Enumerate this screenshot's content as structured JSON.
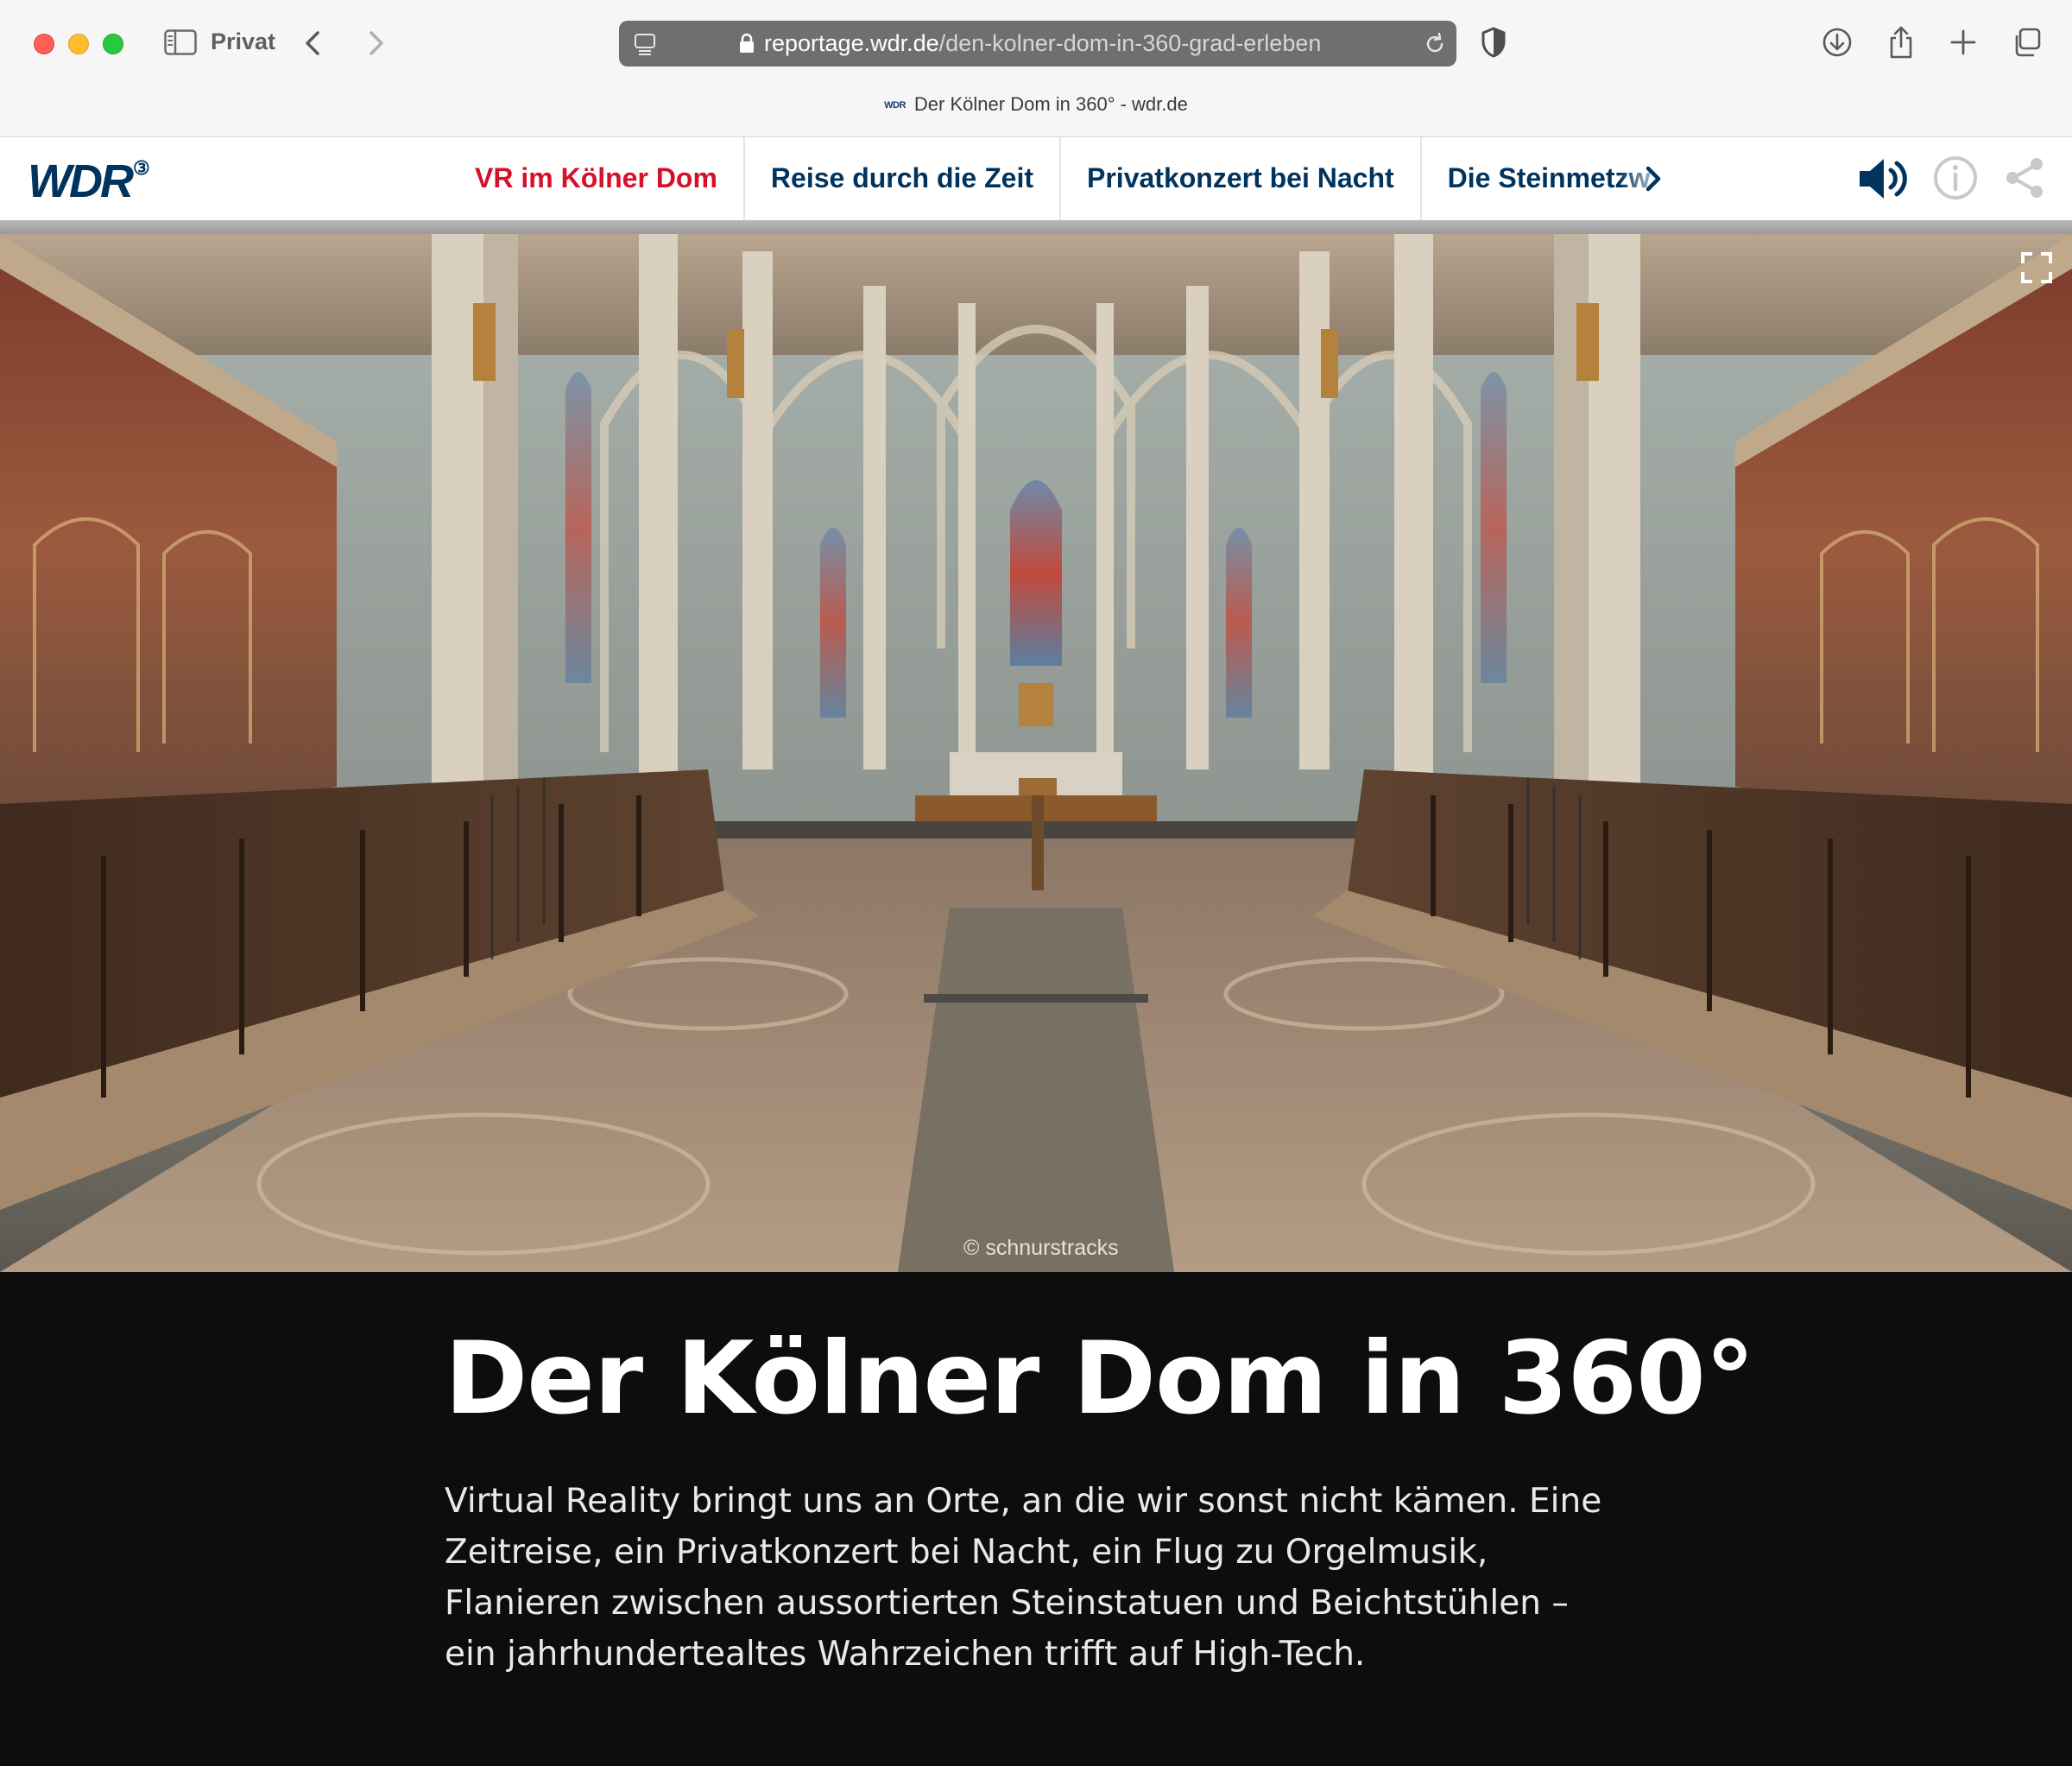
{
  "browser": {
    "profile_label": "Privat",
    "url_host": "reportage.wdr.de",
    "url_path": "/den-kolner-dom-in-360-grad-erleben",
    "tab_favicon_text": "WDR",
    "tab_title": "Der Kölner Dom in 360° - wdr.de"
  },
  "site": {
    "logo_text": "WDR",
    "logo_mark": "3",
    "nav": [
      {
        "label": "VR im Kölner Dom",
        "active": true
      },
      {
        "label": "Reise durch die Zeit"
      },
      {
        "label": "Privatkonzert bei Nacht"
      },
      {
        "label": "Die Steinmetzw"
      }
    ],
    "icons": [
      "speaker-icon",
      "info-icon",
      "share-icon",
      "chevron-right-icon"
    ]
  },
  "panorama": {
    "credit": "© schnurstracks",
    "icon": "fullscreen-icon"
  },
  "intro": {
    "title": "Der Kölner Dom in 360°",
    "text": "Virtual Reality bringt uns an Orte, an die wir sonst nicht kämen. Eine Zeitreise, ein Privatkonzert bei Nacht, ein Flug zu Orgelmusik, Flanieren zwischen aussortierten Steinstatuen und Beichtstühlen – ein jahrhundertealtes Wahrzeichen trifft auf High-Tech."
  },
  "colors": {
    "wdr_blue": "#00345e",
    "active_red": "#d6102a",
    "intro_bg": "#0d0d0d"
  }
}
